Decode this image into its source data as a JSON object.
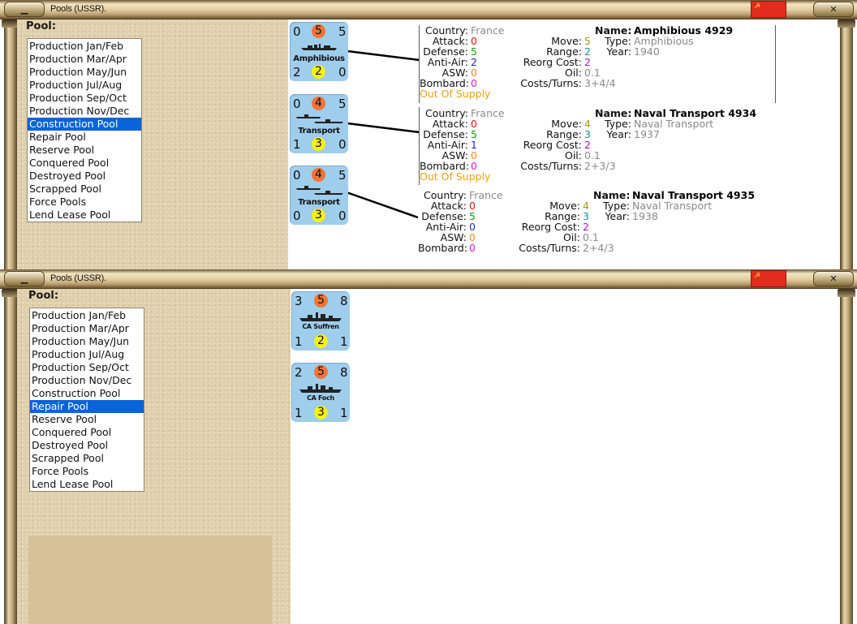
{
  "windows": [
    {
      "title": "Pools (USSR).",
      "flag_symbol": "☭",
      "pool_label": "Pool:",
      "pools": [
        "Production Jan/Feb",
        "Production Mar/Apr",
        "Production May/Jun",
        "Production Jul/Aug",
        "Production Sep/Oct",
        "Production Nov/Dec",
        "Construction Pool",
        "Repair Pool",
        "Reserve Pool",
        "Conquered Pool",
        "Destroyed Pool",
        "Scrapped Pool",
        "Force Pools",
        "Lend Lease Pool"
      ],
      "selected_pool": "Construction Pool",
      "units": [
        {
          "counter": {
            "tl": "0",
            "tc": "5",
            "tr": "5",
            "name": "Amphibious",
            "bl": "2",
            "bc": "2",
            "br": "0"
          },
          "details": {
            "country_label": "Country:",
            "country": "France",
            "attack_label": "Attack:",
            "attack": "0",
            "defense_label": "Defense:",
            "defense": "5",
            "antiair_label": "Anti-Air:",
            "antiair": "2",
            "asw_label": "ASW:",
            "asw": "0",
            "bombard_label": "Bombard:",
            "bombard": "0",
            "supply": "Out Of Supply",
            "move_label": "Move:",
            "move": "5",
            "range_label": "Range:",
            "range": "2",
            "reorg_label": "Reorg Cost:",
            "reorg": "2",
            "oil_label": "Oil:",
            "oil": "0.1",
            "costs_label": "Costs/Turns:",
            "costs": "3+4/4",
            "name_label": "Name:",
            "name": "Amphibious 4929",
            "type_label": "Type:",
            "type": "Amphibious",
            "year_label": "Year:",
            "year": "1940"
          }
        },
        {
          "counter": {
            "tl": "0",
            "tc": "4",
            "tr": "5",
            "name": "Transport",
            "bl": "1",
            "bc": "3",
            "br": "0"
          },
          "details": {
            "country_label": "Country:",
            "country": "France",
            "attack_label": "Attack:",
            "attack": "0",
            "defense_label": "Defense:",
            "defense": "5",
            "antiair_label": "Anti-Air:",
            "antiair": "1",
            "asw_label": "ASW:",
            "asw": "0",
            "bombard_label": "Bombard:",
            "bombard": "0",
            "supply": "Out Of Supply",
            "move_label": "Move:",
            "move": "4",
            "range_label": "Range:",
            "range": "3",
            "reorg_label": "Reorg Cost:",
            "reorg": "2",
            "oil_label": "Oil:",
            "oil": "0.1",
            "costs_label": "Costs/Turns:",
            "costs": "2+3/3",
            "name_label": "Name:",
            "name": "Naval Transport 4934",
            "type_label": "Type:",
            "type": "Naval Transport",
            "year_label": "Year:",
            "year": "1937"
          }
        },
        {
          "counter": {
            "tl": "0",
            "tc": "4",
            "tr": "5",
            "name": "Transport",
            "bl": "0",
            "bc": "3",
            "br": "0"
          },
          "details": {
            "country_label": "Country:",
            "country": "France",
            "attack_label": "Attack:",
            "attack": "0",
            "defense_label": "Defense:",
            "defense": "5",
            "antiair_label": "Anti-Air:",
            "antiair": "0",
            "asw_label": "ASW:",
            "asw": "0",
            "bombard_label": "Bombard:",
            "bombard": "0",
            "move_label": "Move:",
            "move": "4",
            "range_label": "Range:",
            "range": "3",
            "reorg_label": "Reorg Cost:",
            "reorg": "2",
            "oil_label": "Oil:",
            "oil": "0.1",
            "costs_label": "Costs/Turns:",
            "costs": "2+4/3",
            "name_label": "Name:",
            "name": "Naval Transport 4935",
            "type_label": "Type:",
            "type": "Naval Transport",
            "year_label": "Year:",
            "year": "1938"
          }
        }
      ]
    },
    {
      "title": "Pools (USSR).",
      "flag_symbol": "☭",
      "pool_label": "Pool:",
      "pools": [
        "Production Jan/Feb",
        "Production Mar/Apr",
        "Production May/Jun",
        "Production Jul/Aug",
        "Production Sep/Oct",
        "Production Nov/Dec",
        "Construction Pool",
        "Repair Pool",
        "Reserve Pool",
        "Conquered Pool",
        "Destroyed Pool",
        "Scrapped Pool",
        "Force Pools",
        "Lend Lease Pool"
      ],
      "selected_pool": "Repair Pool",
      "units": [
        {
          "counter": {
            "tl": "3",
            "tc": "5",
            "tr": "8",
            "name": "CA Suffren",
            "bl": "1",
            "bc": "2",
            "br": "1"
          }
        },
        {
          "counter": {
            "tl": "2",
            "tc": "5",
            "tr": "8",
            "name": "CA Foch",
            "bl": "1",
            "bc": "3",
            "br": "1"
          }
        }
      ]
    }
  ],
  "colors": {
    "counter_bg": "#9fcdec",
    "strength_circle": "#f07438",
    "experience_circle": "#f4f01c",
    "selection": "#0a64d8",
    "out_of_supply": "#eaa20e"
  }
}
